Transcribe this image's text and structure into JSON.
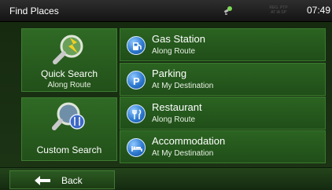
{
  "status": {
    "title": "Find Places",
    "gps_icon": "gps-satellite-icon",
    "faint_line1": "REG. PTP",
    "faint_line2": "AT IA SP",
    "clock": "07:49"
  },
  "tiles": {
    "quick": {
      "label": "Quick Search",
      "sub": "Along Route",
      "icon": "magnifier-lightning-icon"
    },
    "custom": {
      "label": "Custom Search",
      "icon": "magnifier-fork-knife-icon"
    }
  },
  "items": [
    {
      "title": "Gas Station",
      "sub": "Along Route",
      "icon": "gas-station-icon"
    },
    {
      "title": "Parking",
      "sub": "At My Destination",
      "icon": "parking-icon"
    },
    {
      "title": "Restaurant",
      "sub": "Along Route",
      "icon": "restaurant-icon"
    },
    {
      "title": "Accommodation",
      "sub": "At My Destination",
      "icon": "bed-icon"
    }
  ],
  "footer": {
    "back_label": "Back",
    "back_icon": "back-arrow-icon"
  },
  "colors": {
    "panel_green": "#2b6321",
    "status_bar": "#1e1e1e",
    "poi_blue": "#2e7ad1"
  }
}
